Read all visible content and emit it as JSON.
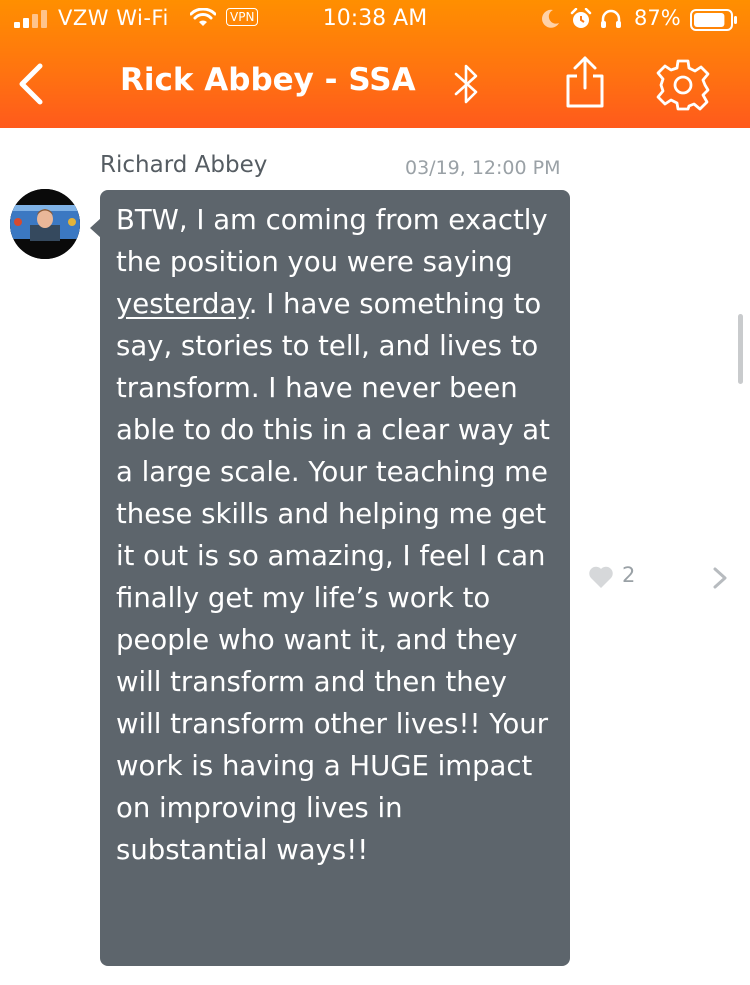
{
  "status_bar": {
    "carrier": "VZW Wi-Fi",
    "vpn": "VPN",
    "time": "10:38 AM",
    "battery_percent": "87%",
    "battery_level": 0.87
  },
  "nav": {
    "title": "Rick Abbey - SSA"
  },
  "message": {
    "sender": "Richard Abbey",
    "timestamp": "03/19, 12:00 PM",
    "text_before_link": "BTW, I am coming from exactly the position you were saying ",
    "link_text": "yesterday",
    "text_after_link": ". I have something to say, stories to tell, and lives to transform. I have never been able to do this in a clear way at a large scale. Your teaching me these skills and helping me get it out is so amazing, I feel I can finally get my life’s work to people who want it, and they will transform and then they will transform other lives!! Your work is having a HUGE impact on improving lives in substantial ways!!",
    "like_count": "2"
  },
  "colors": {
    "header_orange": "#ff7410",
    "bubble": "#5d656c",
    "meta_gray": "#9aa1a6"
  },
  "icons": [
    "back-icon",
    "bluetooth-icon",
    "share-icon",
    "gear-icon",
    "heart-icon",
    "chevron-right-icon"
  ]
}
